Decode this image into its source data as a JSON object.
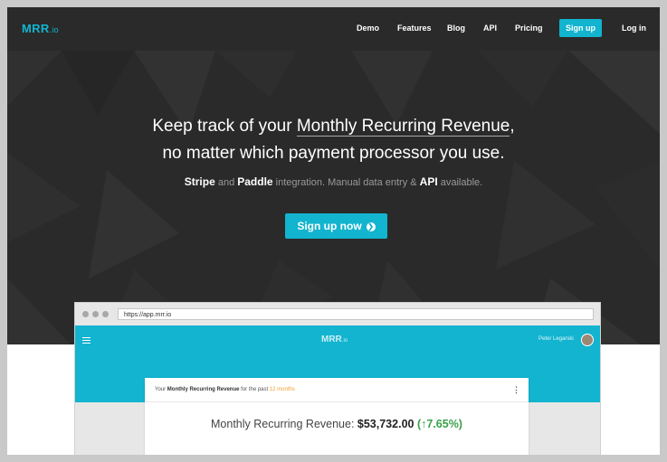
{
  "nav": {
    "logo_main": "MRR",
    "logo_tld": ".io",
    "items": [
      "Demo",
      "Features",
      "Blog",
      "API",
      "Pricing"
    ],
    "signup": "Sign up",
    "login": "Log in"
  },
  "hero": {
    "line1_prefix": "Keep track of your ",
    "line1_highlight": "Monthly Recurring Revenue",
    "line1_suffix": ",",
    "line2": "no matter which payment processor you use.",
    "sub_stripe": "Stripe",
    "sub_and": " and ",
    "sub_paddle": "Paddle",
    "sub_middle": " integration. Manual data entry & ",
    "sub_api": "API",
    "sub_end": " available.",
    "cta": "Sign up now",
    "cta_icon": "chevron-circle-right-icon"
  },
  "preview": {
    "url": "https://app.mrr.io",
    "app_logo": "MRR",
    "app_logo_tld": ".io",
    "user_name": "Peter Legarski",
    "card_prefix": "Your ",
    "card_bold": "Monthly Recurring Revenue",
    "card_mid": " for the past ",
    "card_period": "12 months",
    "mrr_label": "Monthly Recurring Revenue: ",
    "mrr_value": "$53,732.00",
    "mrr_change": "(↑7.65%)"
  },
  "colors": {
    "accent": "#12b4cf",
    "hero_bg": "#2a2a2a",
    "positive": "#3aa04a",
    "highlight": "#f0a030"
  }
}
